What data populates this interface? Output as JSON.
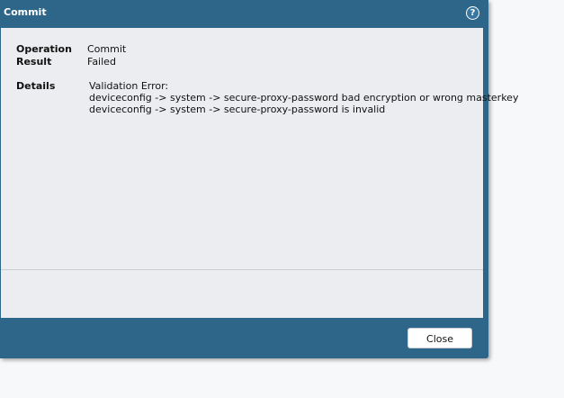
{
  "dialog": {
    "title": "Commit",
    "help_icon": "help-icon",
    "help_symbol": "?"
  },
  "fields": {
    "operation_label": "Operation",
    "operation_value": "Commit",
    "result_label": "Result",
    "result_value": "Failed",
    "details_label": "Details"
  },
  "details": {
    "lines": [
      "Validation Error:",
      "deviceconfig -> system -> secure-proxy-password bad encryption or wrong masterkey",
      "deviceconfig -> system -> secure-proxy-password is invalid"
    ]
  },
  "footer": {
    "close_label": "Close"
  },
  "colors": {
    "titlebar": "#2d6688",
    "panel": "#ebedf0",
    "button_bg": "#ffffff"
  }
}
